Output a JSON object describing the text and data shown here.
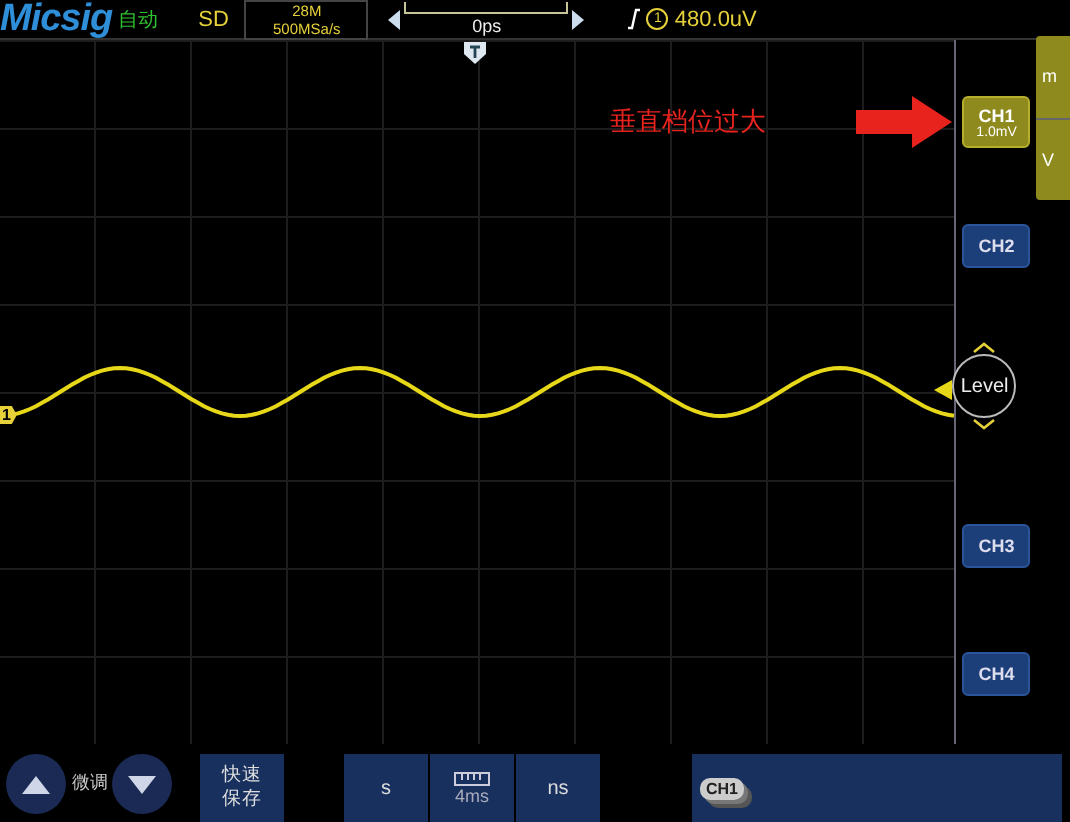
{
  "top_bar": {
    "brand": "Micsig",
    "mode": "自动",
    "acquisition": "SD",
    "memory_depth": "28M",
    "sample_rate": "500MSa/s",
    "delay": "0ps",
    "trigger": {
      "source": "1",
      "level": "480.0uV"
    }
  },
  "plot": {
    "channel_marker": "1",
    "annotation": "垂直档位过大"
  },
  "side_menu": {
    "top_label": "m",
    "bottom_label": "V"
  },
  "channels": [
    {
      "label": "CH1",
      "scale": "1.0mV",
      "selected": true
    },
    {
      "label": "CH2",
      "selected": false
    },
    {
      "label": "CH3",
      "selected": false
    },
    {
      "label": "CH4",
      "selected": false
    }
  ],
  "level_knob": {
    "label": "Level"
  },
  "bottom_bar": {
    "fine_adjust": "微调",
    "quick_save": "快速保存",
    "time_units": [
      {
        "label": "s",
        "kind": "unit"
      },
      {
        "label": "4ms",
        "kind": "value"
      },
      {
        "label": "ns",
        "kind": "unit"
      }
    ],
    "channel_button": "CH1"
  }
}
